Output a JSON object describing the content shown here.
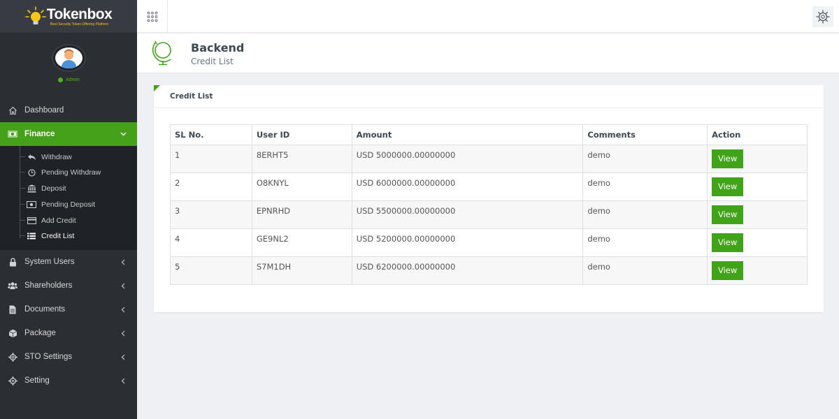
{
  "brand": {
    "name": "Tokenbox",
    "tagline": "Best Security Token Offering Platform"
  },
  "profile": {
    "role": "Admin",
    "status_color": "#55b020"
  },
  "colors": {
    "accent": "#46a11a",
    "sidebar_bg": "#2b2e33",
    "submenu_bg": "#1f2226"
  },
  "sidebar": {
    "items": [
      {
        "label": "Dashboard",
        "icon": "home-icon"
      },
      {
        "label": "Finance",
        "icon": "money-icon",
        "expanded": true
      },
      {
        "label": "System Users",
        "icon": "lock-icon"
      },
      {
        "label": "Shareholders",
        "icon": "users-icon"
      },
      {
        "label": "Documents",
        "icon": "file-icon"
      },
      {
        "label": "Package",
        "icon": "box-icon"
      },
      {
        "label": "STO Settings",
        "icon": "gear-icon"
      },
      {
        "label": "Setting",
        "icon": "gear-icon"
      }
    ],
    "finance_sub": [
      {
        "label": "Withdraw",
        "icon": "reply-icon"
      },
      {
        "label": "Pending Withdraw",
        "icon": "clock-icon"
      },
      {
        "label": "Deposit",
        "icon": "bank-icon"
      },
      {
        "label": "Pending Deposit",
        "icon": "money-icon"
      },
      {
        "label": "Add Credit",
        "icon": "credit-card-icon"
      },
      {
        "label": "Credit List",
        "icon": "list-icon",
        "current": true
      }
    ]
  },
  "header": {
    "title": "Backend",
    "subtitle": "Credit List"
  },
  "card": {
    "title": "Credit List"
  },
  "table": {
    "columns": [
      "SL No.",
      "User ID",
      "Amount",
      "Comments",
      "Action"
    ],
    "rows": [
      {
        "sl": "1",
        "user_id": "8ERHT5",
        "amount": "USD 5000000.00000000",
        "comments": "demo",
        "action": "View"
      },
      {
        "sl": "2",
        "user_id": "O8KNYL",
        "amount": "USD 6000000.00000000",
        "comments": "demo",
        "action": "View"
      },
      {
        "sl": "3",
        "user_id": "EPNRHD",
        "amount": "USD 5500000.00000000",
        "comments": "demo",
        "action": "View"
      },
      {
        "sl": "4",
        "user_id": "GE9NL2",
        "amount": "USD 5200000.00000000",
        "comments": "demo",
        "action": "View"
      },
      {
        "sl": "5",
        "user_id": "S7M1DH",
        "amount": "USD 6200000.00000000",
        "comments": "demo",
        "action": "View"
      }
    ]
  }
}
